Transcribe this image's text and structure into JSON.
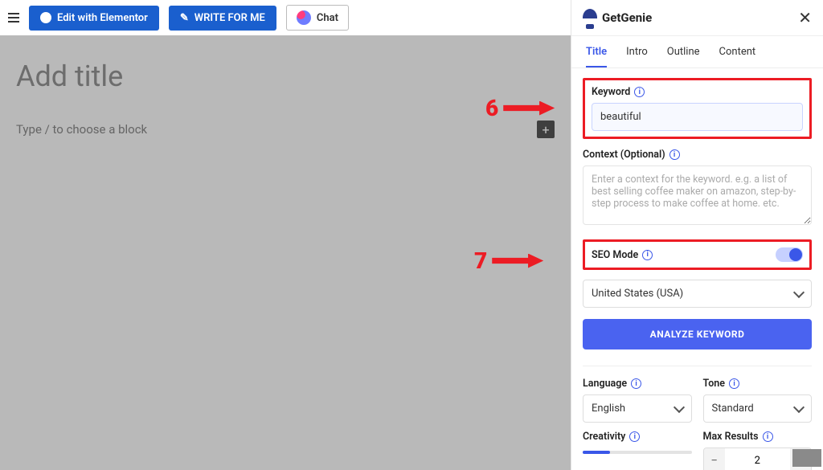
{
  "header": {
    "elementor_label": "Edit with Elementor",
    "write_label": "WRITE FOR ME",
    "chat_label": "Chat"
  },
  "editor": {
    "title_placeholder": "Add title",
    "body_placeholder": "Type / to choose a block"
  },
  "panel": {
    "brand": "GetGenie",
    "tabs": {
      "title": "Title",
      "intro": "Intro",
      "outline": "Outline",
      "content": "Content"
    },
    "keyword_label": "Keyword",
    "keyword_value": "beautiful",
    "context_label": "Context (Optional)",
    "context_placeholder": "Enter a context for the keyword. e.g. a list of best selling coffee maker on amazon, step-by-step process to make coffee at home. etc.",
    "seo_label": "SEO Mode",
    "country_value": "United States (USA)",
    "analyze_label": "ANALYZE KEYWORD",
    "language_label": "Language",
    "language_value": "English",
    "tone_label": "Tone",
    "tone_value": "Standard",
    "creativity_label": "Creativity",
    "max_results_label": "Max Results",
    "max_results_value": "2"
  },
  "callouts": {
    "six": "6",
    "seven": "7"
  }
}
